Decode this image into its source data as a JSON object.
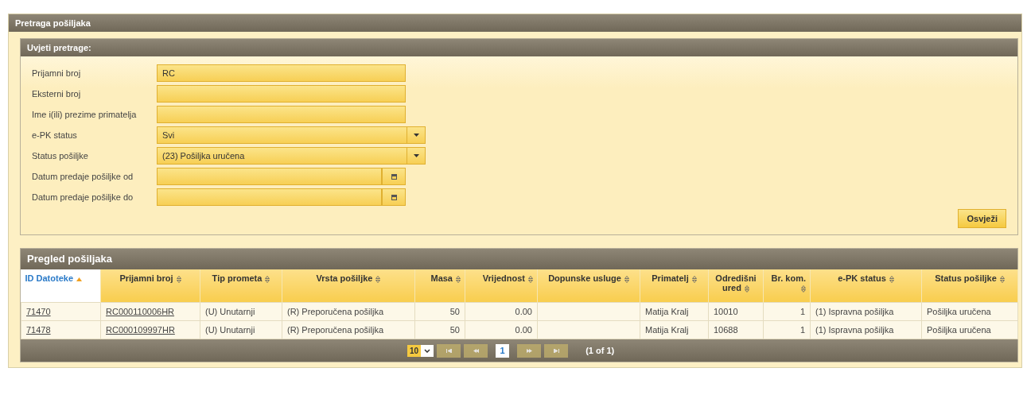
{
  "panel": {
    "title": "Pretraga pošiljaka"
  },
  "criteria": {
    "title": "Uvjeti pretrage:",
    "fields": [
      {
        "kind": "text",
        "label": "Prijamni broj",
        "value": "RC"
      },
      {
        "kind": "text",
        "label": "Eksterni broj"
      },
      {
        "kind": "text",
        "label": "Ime i(ili) prezime primatelja"
      },
      {
        "kind": "select",
        "label": "e-PK status",
        "value": "Svi"
      },
      {
        "kind": "select",
        "label": "Status pošiljke",
        "value": "(23) Pošiljka uručena"
      },
      {
        "kind": "date",
        "label": "Datum predaje pošiljke od"
      },
      {
        "kind": "date",
        "label": "Datum predaje pošiljke do"
      }
    ],
    "button": "Osvježi"
  },
  "table": {
    "title": "Pregled pošiljaka",
    "columns": [
      {
        "label": "ID Datoteke",
        "selected": true,
        "kind": "link"
      },
      {
        "label": "Prijamni broj",
        "selected": false,
        "kind": "link"
      },
      {
        "label": "Tip prometa",
        "selected": false,
        "kind": "text"
      },
      {
        "label": "Vrsta pošiljke",
        "selected": false,
        "kind": "text"
      },
      {
        "label": "Masa",
        "selected": false,
        "kind": "number"
      },
      {
        "label": "Vrijednost",
        "selected": false,
        "kind": "number"
      },
      {
        "label": "Dopunske usluge",
        "selected": false,
        "kind": "text"
      },
      {
        "label": "Primatelj",
        "selected": false,
        "kind": "text"
      },
      {
        "label": "Odredišni ured",
        "selected": false,
        "kind": "text"
      },
      {
        "label": "Br. kom.",
        "selected": false,
        "kind": "number"
      },
      {
        "label": "e-PK status",
        "selected": false,
        "kind": "text"
      },
      {
        "label": "Status pošiljke",
        "selected": false,
        "kind": "text"
      }
    ],
    "rows": [
      [
        "71470",
        "RC000110006HR",
        "(U) Unutarnji",
        "(R) Preporučena pošiljka",
        "50",
        "0.00",
        "",
        "Matija Kralj",
        "10010",
        "1",
        "(1) Ispravna pošiljka",
        "Pošiljka uručena"
      ],
      [
        "71478",
        "RC000109997HR",
        "(U) Unutarnji",
        "(R) Preporučena pošiljka",
        "50",
        "0.00",
        "",
        "Matija Kralj",
        "10688",
        "1",
        "(1) Ispravna pošiljka",
        "Pošiljka uručena"
      ]
    ],
    "pager": {
      "page_size": "10",
      "pages": [
        {
          "label": "1",
          "selected": true
        }
      ],
      "summary": "(1 of 1)",
      "nav_disabled": true
    }
  }
}
